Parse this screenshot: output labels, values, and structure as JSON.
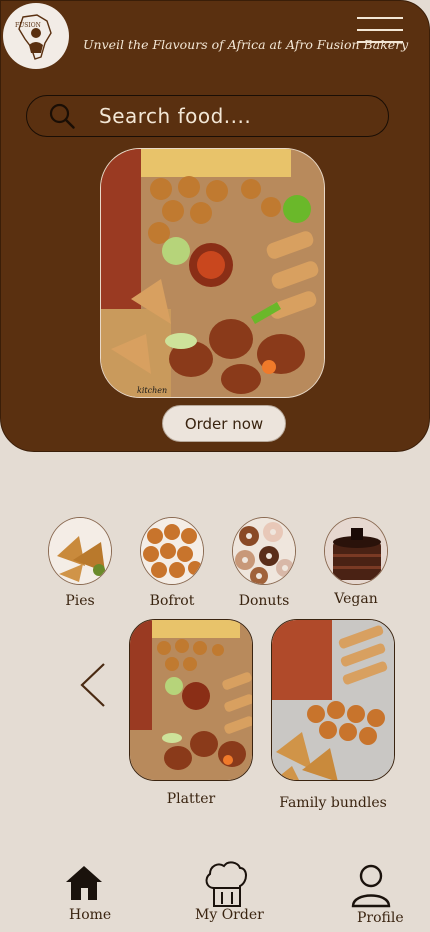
{
  "header": {
    "logo_text": "FUSION",
    "tagline": "Unveil the Flavours of Africa at Afro Fusion Bakery"
  },
  "search": {
    "placeholder": "Search food...."
  },
  "hero": {
    "order_label": "Order now",
    "watermark": "kitchen"
  },
  "categories": [
    {
      "label": "Pies",
      "icon": "pies-photo"
    },
    {
      "label": "Bofrot",
      "icon": "bofrot-photo"
    },
    {
      "label": "Donuts",
      "icon": "donuts-photo"
    },
    {
      "label": "Vegan",
      "icon": "vegan-cake-photo"
    }
  ],
  "featured": [
    {
      "label": "Platter"
    },
    {
      "label": "Family bundles"
    }
  ],
  "bottom_nav": [
    {
      "label": "Home",
      "icon": "home-icon"
    },
    {
      "label": "My Order",
      "icon": "chef-hat-icon"
    },
    {
      "label": "Profile",
      "icon": "user-icon"
    }
  ],
  "colors": {
    "brown": "#5a3010",
    "cream": "#e4dcd3",
    "accent_text": "#f3e7d6"
  }
}
